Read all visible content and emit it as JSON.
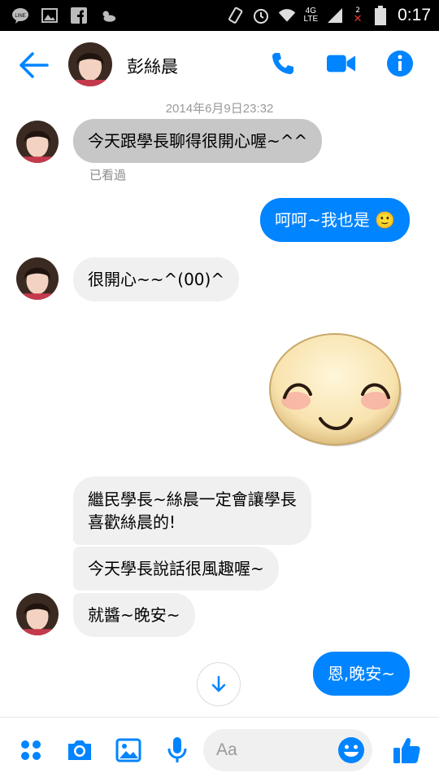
{
  "status_bar": {
    "time": "0:17",
    "network": "4G\nLTE",
    "sim_badge": "2",
    "left_icons": [
      "line-icon",
      "gallery-icon",
      "facebook-icon",
      "weather-icon"
    ],
    "right_icons": [
      "rotate-icon",
      "alarm-icon",
      "wifi-icon",
      "signal-icon",
      "battery-icon"
    ]
  },
  "header": {
    "contact_name": "彭絲晨",
    "icons": [
      "back-arrow-icon",
      "phone-icon",
      "video-camera-icon",
      "info-icon"
    ]
  },
  "chat": {
    "timestamp": "2014年6月9日23:32",
    "seen_label": "已看過",
    "messages": [
      {
        "side": "in",
        "text": "今天跟學長聊得很開心喔~^^"
      },
      {
        "side": "out",
        "text": "呵呵~我也是 🙂"
      },
      {
        "side": "in",
        "text": "很開心~~^(00)^"
      },
      {
        "side": "out",
        "type": "sticker",
        "sticker": "smiling-face-sticker"
      },
      {
        "side": "in",
        "text_line1": "繼民學長~絲晨一定會讓學長",
        "text_line2": "喜歡絲晨的!"
      },
      {
        "side": "in",
        "text": "今天學長說話很風趣喔~"
      },
      {
        "side": "in",
        "text": "就醬~晚安~"
      },
      {
        "side": "out",
        "text": "恩,晚安~"
      }
    ]
  },
  "composer": {
    "placeholder": "Aa",
    "icons": [
      "apps-grid-icon",
      "camera-icon",
      "image-icon",
      "microphone-icon",
      "emoji-icon",
      "thumbs-up-icon"
    ]
  },
  "colors": {
    "accent": "#0084ff",
    "incoming_bubble": "#f1f0f0",
    "highlighted_bubble": "#c7c7c7"
  }
}
